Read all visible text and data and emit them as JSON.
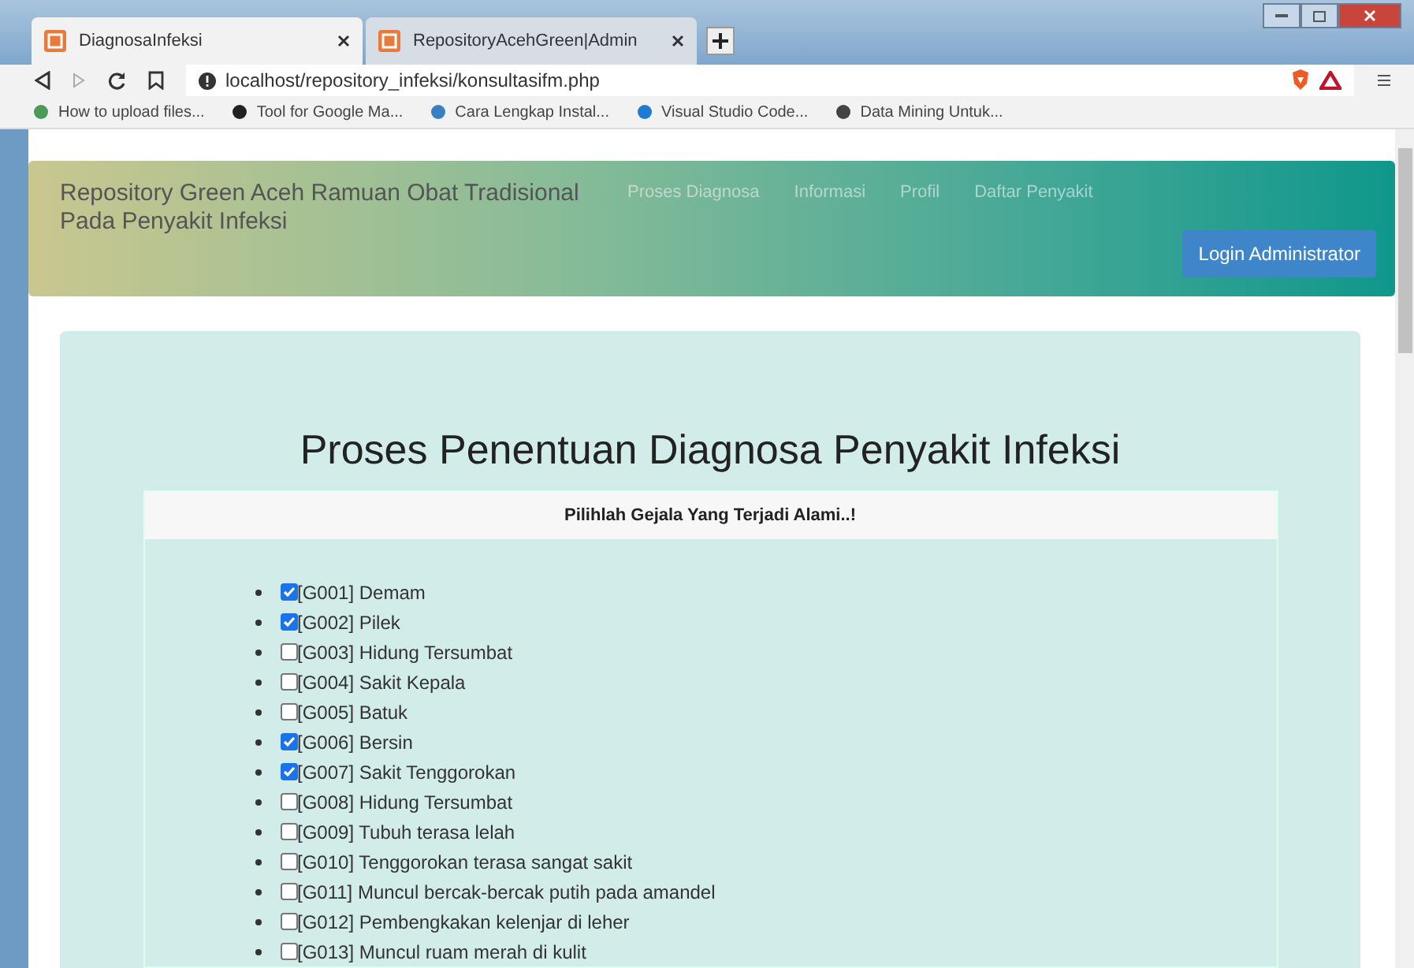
{
  "tabs": [
    {
      "title": "DiagnosaInfeksi",
      "selected": true
    },
    {
      "title": "RepositoryAcehGreen|Admin",
      "selected": false
    }
  ],
  "address": "localhost/repository_infeksi/konsultasifm.php",
  "bookmarks": [
    "How to upload files...",
    "Tool for Google Ma...",
    "Cara Lengkap Instal...",
    "Visual Studio Code...",
    "Data Mining Untuk..."
  ],
  "navbar": {
    "brand": "Repository Green Aceh Ramuan Obat Tradisional Pada Penyakit Infeksi",
    "links": [
      "Proses Diagnosa",
      "Informasi",
      "Profil",
      "Daftar Penyakit"
    ],
    "login": "Login Administrator"
  },
  "heading": "Proses Penentuan Diagnosa Penyakit Infeksi",
  "card_header": "Pilihlah Gejala Yang Terjadi Alami..!",
  "symptoms": [
    {
      "label": "[G001] Demam",
      "checked": true
    },
    {
      "label": "[G002] Pilek",
      "checked": true
    },
    {
      "label": "[G003] Hidung Tersumbat",
      "checked": false
    },
    {
      "label": "[G004] Sakit Kepala",
      "checked": false
    },
    {
      "label": "[G005] Batuk",
      "checked": false
    },
    {
      "label": "[G006] Bersin",
      "checked": true
    },
    {
      "label": "[G007] Sakit Tenggorokan",
      "checked": true
    },
    {
      "label": "[G008] Hidung Tersumbat",
      "checked": false
    },
    {
      "label": "[G009] Tubuh terasa lelah",
      "checked": false
    },
    {
      "label": "[G010] Tenggorokan terasa sangat sakit",
      "checked": false
    },
    {
      "label": "[G011] Muncul bercak-bercak putih pada amandel",
      "checked": false
    },
    {
      "label": "[G012] Pembengkakan kelenjar di leher",
      "checked": false
    },
    {
      "label": "[G013] Muncul ruam merah di kulit",
      "checked": false
    }
  ]
}
